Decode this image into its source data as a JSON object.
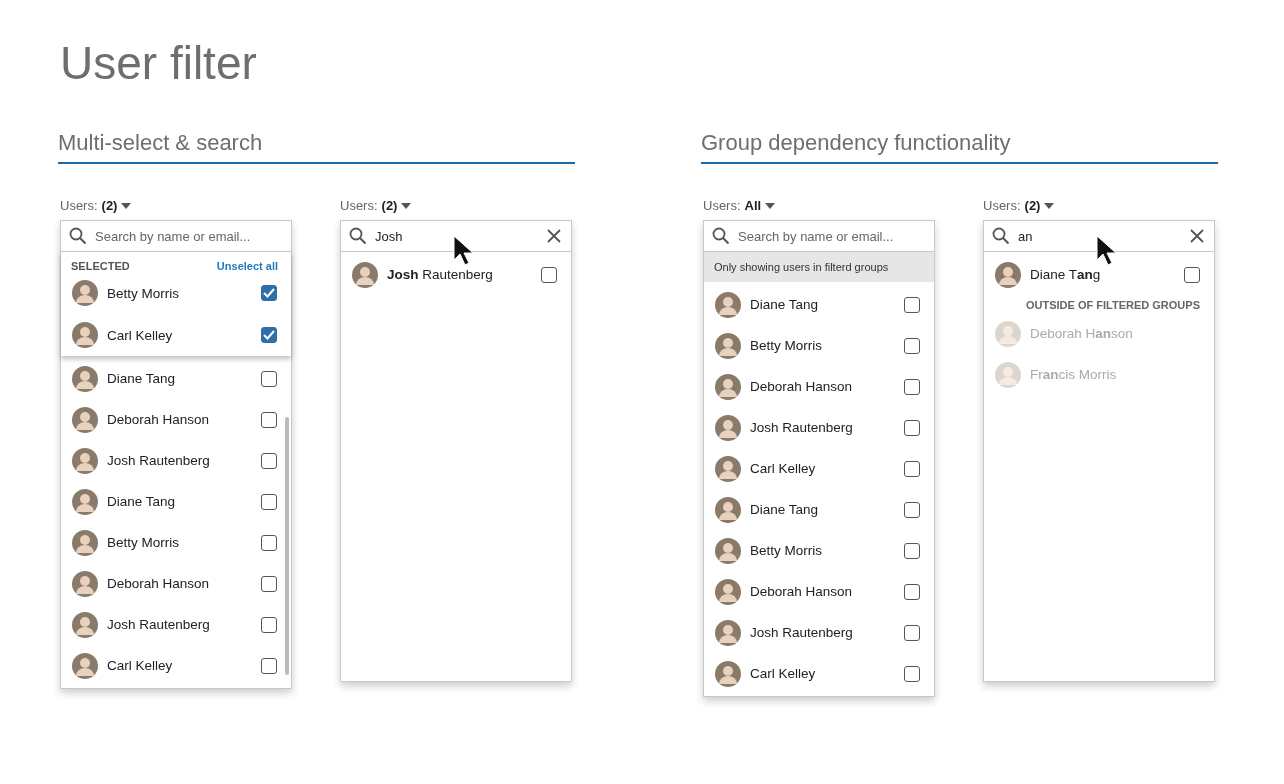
{
  "title": "User filter",
  "sections": [
    {
      "title": "Multi-select & search",
      "panels": [
        {
          "label": "Users:",
          "value": "(2)",
          "search": {
            "placeholder": "Search by name or email...",
            "clear": false
          },
          "selected_block": {
            "heading": "SELECTED",
            "action": "Unselect all",
            "users": [
              {
                "name": "Betty Morris",
                "checked": true
              },
              {
                "name": "Carl Kelley",
                "checked": true
              }
            ]
          },
          "users": [
            {
              "name": "Diane Tang",
              "checked": false
            },
            {
              "name": "Deborah Hanson",
              "checked": false
            },
            {
              "name": "Josh Rautenberg",
              "checked": false
            },
            {
              "name": "Diane Tang",
              "checked": false
            },
            {
              "name": "Betty Morris",
              "checked": false
            },
            {
              "name": "Deborah Hanson",
              "checked": false
            },
            {
              "name": "Josh Rautenberg",
              "checked": false
            },
            {
              "name": "Carl Kelley",
              "checked": false
            }
          ],
          "scrollbar": true,
          "pointer": false
        },
        {
          "label": "Users:",
          "value": "(2)",
          "search": {
            "value": "Josh",
            "clear": true
          },
          "users": [
            {
              "name": "**Josh** Rautenberg",
              "checked": false
            }
          ],
          "scrollbar": false,
          "pointer": true
        }
      ]
    },
    {
      "title": "Group dependency functionality",
      "panels": [
        {
          "label": "Users:",
          "value": "All",
          "search": {
            "placeholder": "Search by name or email...",
            "clear": false
          },
          "notice": "Only showing users in filterd groups",
          "users": [
            {
              "name": "Diane Tang",
              "checked": false
            },
            {
              "name": "Betty Morris",
              "checked": false
            },
            {
              "name": "Deborah Hanson",
              "checked": false
            },
            {
              "name": "Josh Rautenberg",
              "checked": false
            },
            {
              "name": "Carl Kelley",
              "checked": false
            },
            {
              "name": "Diane Tang",
              "checked": false
            },
            {
              "name": "Betty Morris",
              "checked": false
            },
            {
              "name": "Deborah Hanson",
              "checked": false
            },
            {
              "name": "Josh Rautenberg",
              "checked": false
            },
            {
              "name": "Carl Kelley",
              "checked": false
            }
          ],
          "scrollbar": false,
          "pointer": false
        },
        {
          "label": "Users:",
          "value": "(2)",
          "search": {
            "value": "an",
            "clear": true
          },
          "users": [
            {
              "name": "Diane T**an**g",
              "checked": false
            }
          ],
          "outside": {
            "heading": "OUTSIDE OF FILTERED GROUPS",
            "users": [
              {
                "name": "Deborah H**an**son"
              },
              {
                "name": "Fr**an**cis Morris"
              }
            ]
          },
          "scrollbar": false,
          "pointer": true
        }
      ]
    }
  ]
}
